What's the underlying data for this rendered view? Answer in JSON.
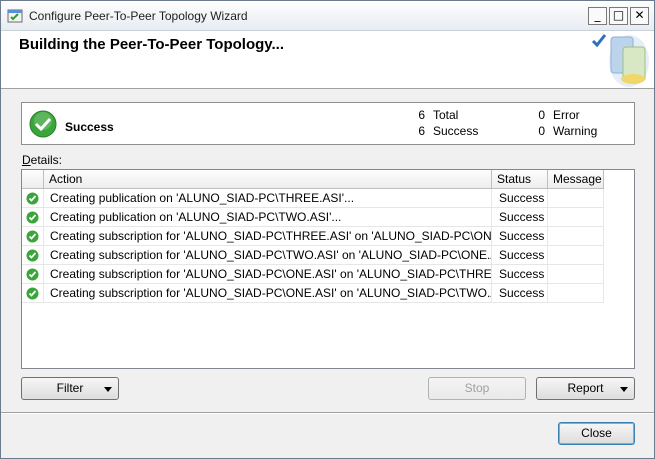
{
  "window": {
    "title": "Configure Peer-To-Peer Topology Wizard",
    "minimize_label": "_",
    "maximize_label": "□",
    "close_label": "✕"
  },
  "header": {
    "title": "Building the Peer-To-Peer Topology..."
  },
  "summary": {
    "status": "Success",
    "total_count": "6",
    "total_label": "Total",
    "success_count": "6",
    "success_label": "Success",
    "error_count": "0",
    "error_label": "Error",
    "warning_count": "0",
    "warning_label": "Warning"
  },
  "details": {
    "label_underlined": "D",
    "label_rest": "etails:",
    "columns": [
      "Action",
      "Status",
      "Message"
    ],
    "rows": [
      {
        "action": "Creating publication on 'ALUNO_SIAD-PC\\THREE.ASI'...",
        "status": "Success",
        "message": ""
      },
      {
        "action": "Creating publication on 'ALUNO_SIAD-PC\\TWO.ASI'...",
        "status": "Success",
        "message": ""
      },
      {
        "action": "Creating subscription for 'ALUNO_SIAD-PC\\THREE.ASI' on 'ALUNO_SIAD-PC\\ONE.ASI'...",
        "status": "Success",
        "message": ""
      },
      {
        "action": "Creating subscription for 'ALUNO_SIAD-PC\\TWO.ASI' on 'ALUNO_SIAD-PC\\ONE.ASI'...",
        "status": "Success",
        "message": ""
      },
      {
        "action": "Creating subscription for 'ALUNO_SIAD-PC\\ONE.ASI' on 'ALUNO_SIAD-PC\\THREE.ASI'...",
        "status": "Success",
        "message": ""
      },
      {
        "action": "Creating subscription for 'ALUNO_SIAD-PC\\ONE.ASI' on 'ALUNO_SIAD-PC\\TWO.ASI'...",
        "status": "Success",
        "message": ""
      }
    ]
  },
  "buttons": {
    "filter": "Filter",
    "stop": "Stop",
    "report": "Report",
    "close": "Close"
  },
  "colors": {
    "success_green": "#3aa53a",
    "title_bar": "#e7ecf2",
    "default_button_border": "#3c7fb1"
  },
  "icons": {
    "app": "wizard-icon",
    "status": "success-check-icon",
    "header_graphic": "database-replication-icon"
  }
}
